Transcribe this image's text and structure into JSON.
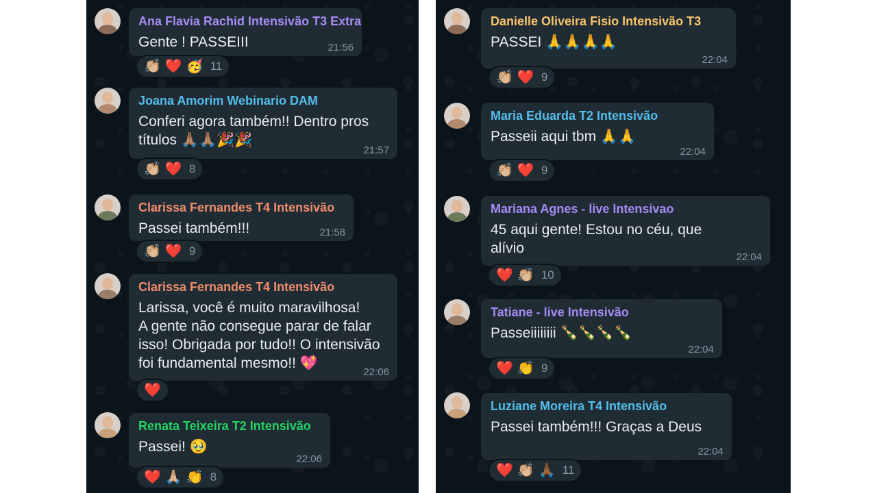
{
  "left_messages": [
    {
      "sender": "Ana Flavia Rachid Intensivão T3 Extra",
      "sender_color": "#a58cf5",
      "text": "Gente ! PASSEIII",
      "time": "21:56",
      "reactions": {
        "emojis": [
          "👏🏼",
          "❤️",
          "🥳"
        ],
        "count": "11"
      }
    },
    {
      "sender": "Joana Amorim Webinario DAM",
      "sender_color": "#53bdeb",
      "text": "Conferi agora também!! Dentro pros\ntítulos 🙏🏽🙏🏽🎉🎉",
      "time": "21:57",
      "reactions": {
        "emojis": [
          "👏🏼",
          "❤️"
        ],
        "count": "8"
      }
    },
    {
      "sender": "Clarissa Fernandes T4 Intensivão",
      "sender_color": "#ee8c6c",
      "text": "Passei também!!!",
      "time": "21:58",
      "reactions": {
        "emojis": [
          "👏🏼",
          "❤️"
        ],
        "count": "9"
      }
    },
    {
      "sender": "Clarissa Fernandes T4 Intensivão",
      "sender_color": "#ee8c6c",
      "text": "Larissa, você é muito maravilhosa!\nA gente não consegue parar de falar\nisso! Obrigada por tudo!! O intensivão\nfoi fundamental mesmo!! 💖",
      "time": "22:06",
      "reactions": {
        "emojis": [
          "❤️"
        ],
        "count": ""
      }
    },
    {
      "sender": "Renata Teixeira T2 Intensivão",
      "sender_color": "#25d366",
      "text": "Passei! 🥹",
      "time": "22:06",
      "reactions": {
        "emojis": [
          "❤️",
          "🙏🏼",
          "👏"
        ],
        "count": "8"
      }
    }
  ],
  "right_messages": [
    {
      "sender": "Danielle Oliveira Fisio Intensivão T3",
      "sender_color": "#f7c46c",
      "text": "PASSEI 🙏🙏🙏🙏",
      "time": "22:04",
      "reactions": {
        "emojis": [
          "👏🏼",
          "❤️"
        ],
        "count": "9"
      }
    },
    {
      "sender": "Maria Eduarda T2 Intensivão",
      "sender_color": "#53bdeb",
      "text": "Passeii aqui tbm 🙏🙏",
      "time": "22:04",
      "reactions": {
        "emojis": [
          "👏🏼",
          "❤️"
        ],
        "count": "9"
      }
    },
    {
      "sender": "Mariana Agnes - live Intensivao",
      "sender_color": "#a58cf5",
      "text": "45 aqui gente! Estou no céu, que\nalívio",
      "time": "22:04",
      "reactions": {
        "emojis": [
          "❤️",
          "👏🏼"
        ],
        "count": "10"
      }
    },
    {
      "sender": "Tatiane - live Intensivão",
      "sender_color": "#a58cf5",
      "text": "Passeiiiiiiii 🍾🍾🍾🍾",
      "time": "22:04",
      "reactions": {
        "emojis": [
          "❤️",
          "👏"
        ],
        "count": "9"
      }
    },
    {
      "sender": "Luziane Moreira T4 Intensivão",
      "sender_color": "#53bdeb",
      "text": "Passei também!!! Graças a Deus",
      "time": "22:04",
      "reactions": {
        "emojis": [
          "❤️",
          "👏🏼",
          "🙏🏾"
        ],
        "count": "11"
      }
    }
  ],
  "colors": {
    "chat_background": "#0b141a",
    "bubble": "#202c33",
    "text": "#e9edef",
    "meta": "#8696a0"
  }
}
